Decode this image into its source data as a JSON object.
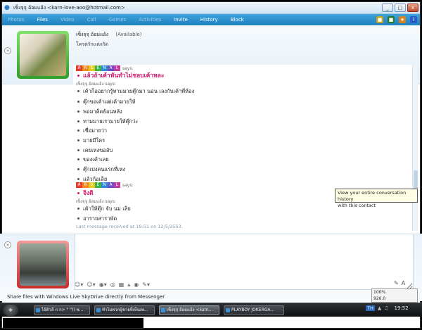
{
  "window": {
    "title": "เซ็งจุจุ อ้อมแอ้ง <karn-love-aoo@hotmail.com>",
    "controls": [
      "_",
      "□",
      "x"
    ]
  },
  "menu": {
    "items": [
      "Photos",
      "Files",
      "Video",
      "Call",
      "Games",
      "Activities",
      "Invite",
      "History",
      "Block"
    ],
    "active": [
      "Files",
      "Invite",
      "History",
      "Block"
    ]
  },
  "contact": {
    "name": "เซ็งจุจุ อ้อมแอ้ง",
    "status": "(Available)",
    "personal_message": "โครตรักแต่งกัด"
  },
  "conversation": {
    "lines": [
      {
        "kind": "arsenal",
        "text": "says:"
      },
      {
        "kind": "pink",
        "text": "แล้วถ้าเค้าหันทำไม่ชอบเค้าหละ"
      },
      {
        "kind": "sender",
        "text": "เซ็งจุจุ อ้อมแอ้ง says:"
      },
      {
        "kind": "msg",
        "text": "เค้าก็ออยากรู้ทามมายตุ๊กมา นอน เลงกับเค้าที่ห้อง"
      },
      {
        "kind": "msg",
        "text": "ตุ๊กขอเค้าแต่เค้ามายให้"
      },
      {
        "kind": "msg",
        "text": "พอมาคิดย้อนหลัง"
      },
      {
        "kind": "msg",
        "text": "ทามมายเรามายให้ตุ๊กว่ะ"
      },
      {
        "kind": "msg",
        "text": "เชื่อมายว่า"
      },
      {
        "kind": "msg",
        "text": "มายมีใคร"
      },
      {
        "kind": "msg",
        "text": "เคยเหงขอลับ"
      },
      {
        "kind": "msg",
        "text": "ของเค้าเลย"
      },
      {
        "kind": "msg",
        "text": "ตุ๊กเปงคนแรกที่เหง"
      },
      {
        "kind": "msg",
        "text": "แล้วก้อเลิย"
      },
      {
        "kind": "arsenal",
        "text": "says:"
      },
      {
        "kind": "pink",
        "text": "จิงดิ"
      },
      {
        "kind": "sender",
        "text": "เซ็งจุจุ อ้อมแอ้ง says:"
      },
      {
        "kind": "msg",
        "text": "เค้าให้ตุ๊ก จับ นม เลิย"
      },
      {
        "kind": "msg",
        "text": "อารายสาราพัด"
      },
      {
        "kind": "lastmsg",
        "text": "Last message received at 19:51 on 12/5/2553."
      }
    ],
    "arsenal_letters": [
      "A",
      "R",
      "S",
      "E",
      "N",
      "A",
      "L"
    ],
    "arsenal_colors": [
      "#e53a2e",
      "#f08a1e",
      "#e8c81c",
      "#3cb24a",
      "#2a8ad6",
      "#6a4cc8",
      "#c23aa0"
    ]
  },
  "tooltip": {
    "line1": "View your entire conversation history",
    "line2": "with this contact"
  },
  "compose": {
    "value": ""
  },
  "toolbar": {
    "icons": [
      "emoticon-icon",
      "wink-icon",
      "nudge-icon",
      "voice-clip-icon",
      "background-icon",
      "games-icon",
      "font-icon",
      "ink-icon"
    ]
  },
  "footer": {
    "skydrive": "Share files with Windows Live SkyDrive directly from Messenger"
  },
  "taskbar": {
    "tasks": [
      "ไอ้ติวลี ก ก> \" \")) พ...",
      "ทำไมพวกผู้ชายที่เห็นเพ...",
      "เซ็งจุจุ อ้อมแอ้ง <karn...",
      "PLAYBOY JOKERGA..."
    ],
    "lang": "TH",
    "clock": "19:52",
    "zoom": "100%",
    "zoom_label": "926.0"
  },
  "caption": "[1024x768] https://upic.me/"
}
